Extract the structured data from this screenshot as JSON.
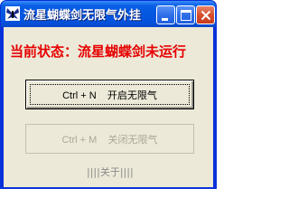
{
  "window": {
    "title": "流星蝴蝶剑无限气外挂",
    "icon": "butterfly-app-icon",
    "controls": {
      "minimize_icon": "minimize-icon",
      "maximize_icon": "maximize-icon",
      "close_icon": "close-icon"
    }
  },
  "main": {
    "status_text": "当前状态：流星蝴蝶剑未运行",
    "enable_button_label": "Ctrl + N    开启无限气",
    "disable_button_label": "Ctrl + M    关闭无限气",
    "about_label": "||||关于||||"
  },
  "colors": {
    "status_text": "#e60000",
    "titlebar": "#0457e0",
    "client_bg": "#ece9d8",
    "disabled_text": "#aca899"
  }
}
